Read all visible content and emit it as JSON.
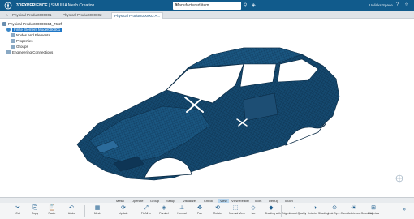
{
  "app": {
    "brand_bold": "3DEXPERIENCE",
    "brand_rest": " | SIMULIA Mesh Creation",
    "search_value": "Manufactured item",
    "user": "Unlinks Space"
  },
  "tabs": [
    {
      "label": "Physical Product000001",
      "active": false
    },
    {
      "label": "Physical Product000002",
      "active": false
    },
    {
      "label": "Physical Product000003 A...",
      "active": true
    }
  ],
  "tree": {
    "root": "Physical Product00000654_76.2f",
    "selected": "Finite Element Model000001",
    "children": [
      "Nodes and Elements",
      "Properties",
      "Groups",
      "Engineering Connections"
    ]
  },
  "section_tabs": [
    {
      "label": "Mesh",
      "active": false
    },
    {
      "label": "Operate",
      "active": false
    },
    {
      "label": "Group",
      "active": false
    },
    {
      "label": "Setup",
      "active": false
    },
    {
      "label": "Visualize",
      "active": false
    },
    {
      "label": "Check",
      "active": false
    },
    {
      "label": "View",
      "active": true
    },
    {
      "label": "View Reality",
      "active": false
    },
    {
      "label": "Tools",
      "active": false
    },
    {
      "label": "Debug",
      "active": false
    },
    {
      "label": "Touch",
      "active": false
    }
  ],
  "actions": [
    {
      "label": "Cut",
      "icon": "scissors-icon",
      "glyph": "✂"
    },
    {
      "label": "Copy",
      "icon": "copy-icon",
      "glyph": "⎘"
    },
    {
      "label": "Paste",
      "icon": "paste-icon",
      "glyph": "📋"
    },
    {
      "label": "Undo",
      "icon": "undo-icon",
      "glyph": "↶"
    },
    {
      "label": "Mesh",
      "icon": "mesh-icon",
      "glyph": "▦"
    },
    {
      "label": "Update",
      "icon": "update-icon",
      "glyph": "⟳"
    },
    {
      "label": "Fit All In",
      "icon": "fit-all-icon",
      "glyph": "⤢"
    },
    {
      "label": "Parallel",
      "icon": "parallel-icon",
      "glyph": "◈"
    },
    {
      "label": "Normal",
      "icon": "normal-icon",
      "glyph": "⊥"
    },
    {
      "label": "Pan",
      "icon": "pan-icon",
      "glyph": "✥"
    },
    {
      "label": "Rotate",
      "icon": "rotate-icon",
      "glyph": "⟲"
    },
    {
      "label": "Normal View",
      "icon": "normal-view-icon",
      "glyph": "⬚"
    },
    {
      "label": "Iso",
      "icon": "iso-icon",
      "glyph": "◇"
    },
    {
      "label": "Shading with Edges",
      "icon": "shading-icon",
      "glyph": "◆"
    },
    {
      "label": "Visual Quality",
      "icon": "visual-quality-icon",
      "glyph": "◐"
    },
    {
      "label": "Interior Shading",
      "icon": "interior-shading-icon",
      "glyph": "◑"
    },
    {
      "label": "Link Dyn. Cam",
      "icon": "link-camera-icon",
      "glyph": "⊙"
    },
    {
      "label": "Ambience Geometry",
      "icon": "ambience-icon",
      "glyph": "☀"
    },
    {
      "label": "Multiview",
      "icon": "multiview-icon",
      "glyph": "⊞"
    }
  ],
  "colors": {
    "titlebar": "#115b8c",
    "mesh_fill": "#15496f",
    "mesh_line": "#0b2b45",
    "selection": "#1f77c7"
  }
}
